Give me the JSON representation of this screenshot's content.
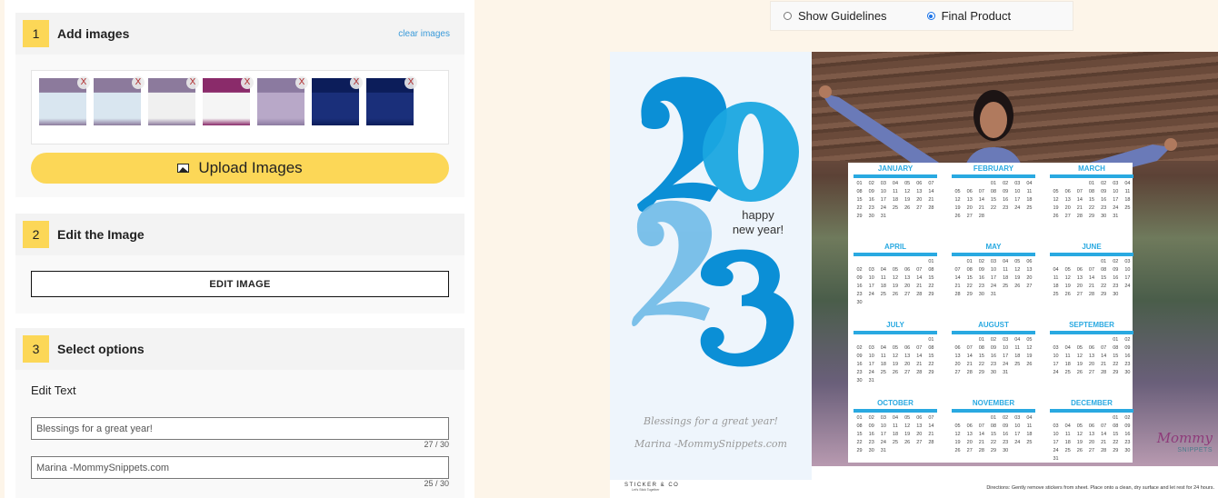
{
  "steps": [
    {
      "number": "1",
      "title": "Add images",
      "action_link": "clear images"
    },
    {
      "number": "2",
      "title": "Edit the Image"
    },
    {
      "number": "3",
      "title": "Select options"
    }
  ],
  "images": {
    "thumbnails": [
      {
        "name": "photo-calendar-blue-1",
        "remove": "X",
        "colors": [
          "#8c7a9c",
          "#d9e6f0"
        ]
      },
      {
        "name": "photo-calendar-blue-2",
        "remove": "X",
        "colors": [
          "#8c7a9c",
          "#d9e6f0"
        ]
      },
      {
        "name": "photo-calendar-black",
        "remove": "X",
        "colors": [
          "#8c7a9c",
          "#f0f0f0"
        ]
      },
      {
        "name": "pattern-calendar",
        "remove": "X",
        "colors": [
          "#8a2b6a",
          "#f5f5f5"
        ]
      },
      {
        "name": "photo-jump",
        "remove": "X",
        "colors": [
          "#8b7aa0",
          "#b8a8c8"
        ]
      },
      {
        "name": "starry-night-1",
        "remove": "X",
        "colors": [
          "#0c1d5a",
          "#1a2f7a"
        ]
      },
      {
        "name": "starry-night-2",
        "remove": "X",
        "colors": [
          "#0c1d5a",
          "#1a2f7a"
        ]
      }
    ],
    "upload_label": "Upload Images",
    "upload_icon": "image-icon"
  },
  "edit": {
    "button_label": "EDIT IMAGE"
  },
  "options": {
    "edit_text_label": "Edit Text",
    "fields": [
      {
        "value": "Blessings for a great year!",
        "counter": "27 / 30"
      },
      {
        "value": "Marina -MommySnippets.com",
        "counter": "25 / 30"
      }
    ]
  },
  "view_toggle": {
    "options": [
      {
        "label": "Show Guidelines",
        "selected": false
      },
      {
        "label": "Final Product",
        "selected": true
      }
    ]
  },
  "preview": {
    "year": "2023",
    "greeting_line1": "happy",
    "greeting_line2": "new year!",
    "message1": "Blessings for a great year!",
    "message2": "Marina -MommySnippets.com",
    "brand": "STICKER & CO",
    "brand_tagline": "Let's Stick Together",
    "directions": "Directions: Gently remove stickers from sheet. Place onto a clean, dry surface and let rest for 24 hours.",
    "watermark": "Mommy",
    "watermark_sub": "SNIPPETS",
    "accent_color": "#29a9e1",
    "calendar": [
      {
        "month": "JANUARY",
        "offset": 0,
        "days": 31
      },
      {
        "month": "FEBRUARY",
        "offset": 3,
        "days": 28
      },
      {
        "month": "MARCH",
        "offset": 3,
        "days": 31
      },
      {
        "month": "APRIL",
        "offset": 6,
        "days": 30
      },
      {
        "month": "MAY",
        "offset": 1,
        "days": 31
      },
      {
        "month": "JUNE",
        "offset": 4,
        "days": 30
      },
      {
        "month": "JULY",
        "offset": 6,
        "days": 31
      },
      {
        "month": "AUGUST",
        "offset": 2,
        "days": 31
      },
      {
        "month": "SEPTEMBER",
        "offset": 5,
        "days": 30
      },
      {
        "month": "OCTOBER",
        "offset": 0,
        "days": 31
      },
      {
        "month": "NOVEMBER",
        "offset": 3,
        "days": 30
      },
      {
        "month": "DECEMBER",
        "offset": 5,
        "days": 31
      }
    ]
  }
}
